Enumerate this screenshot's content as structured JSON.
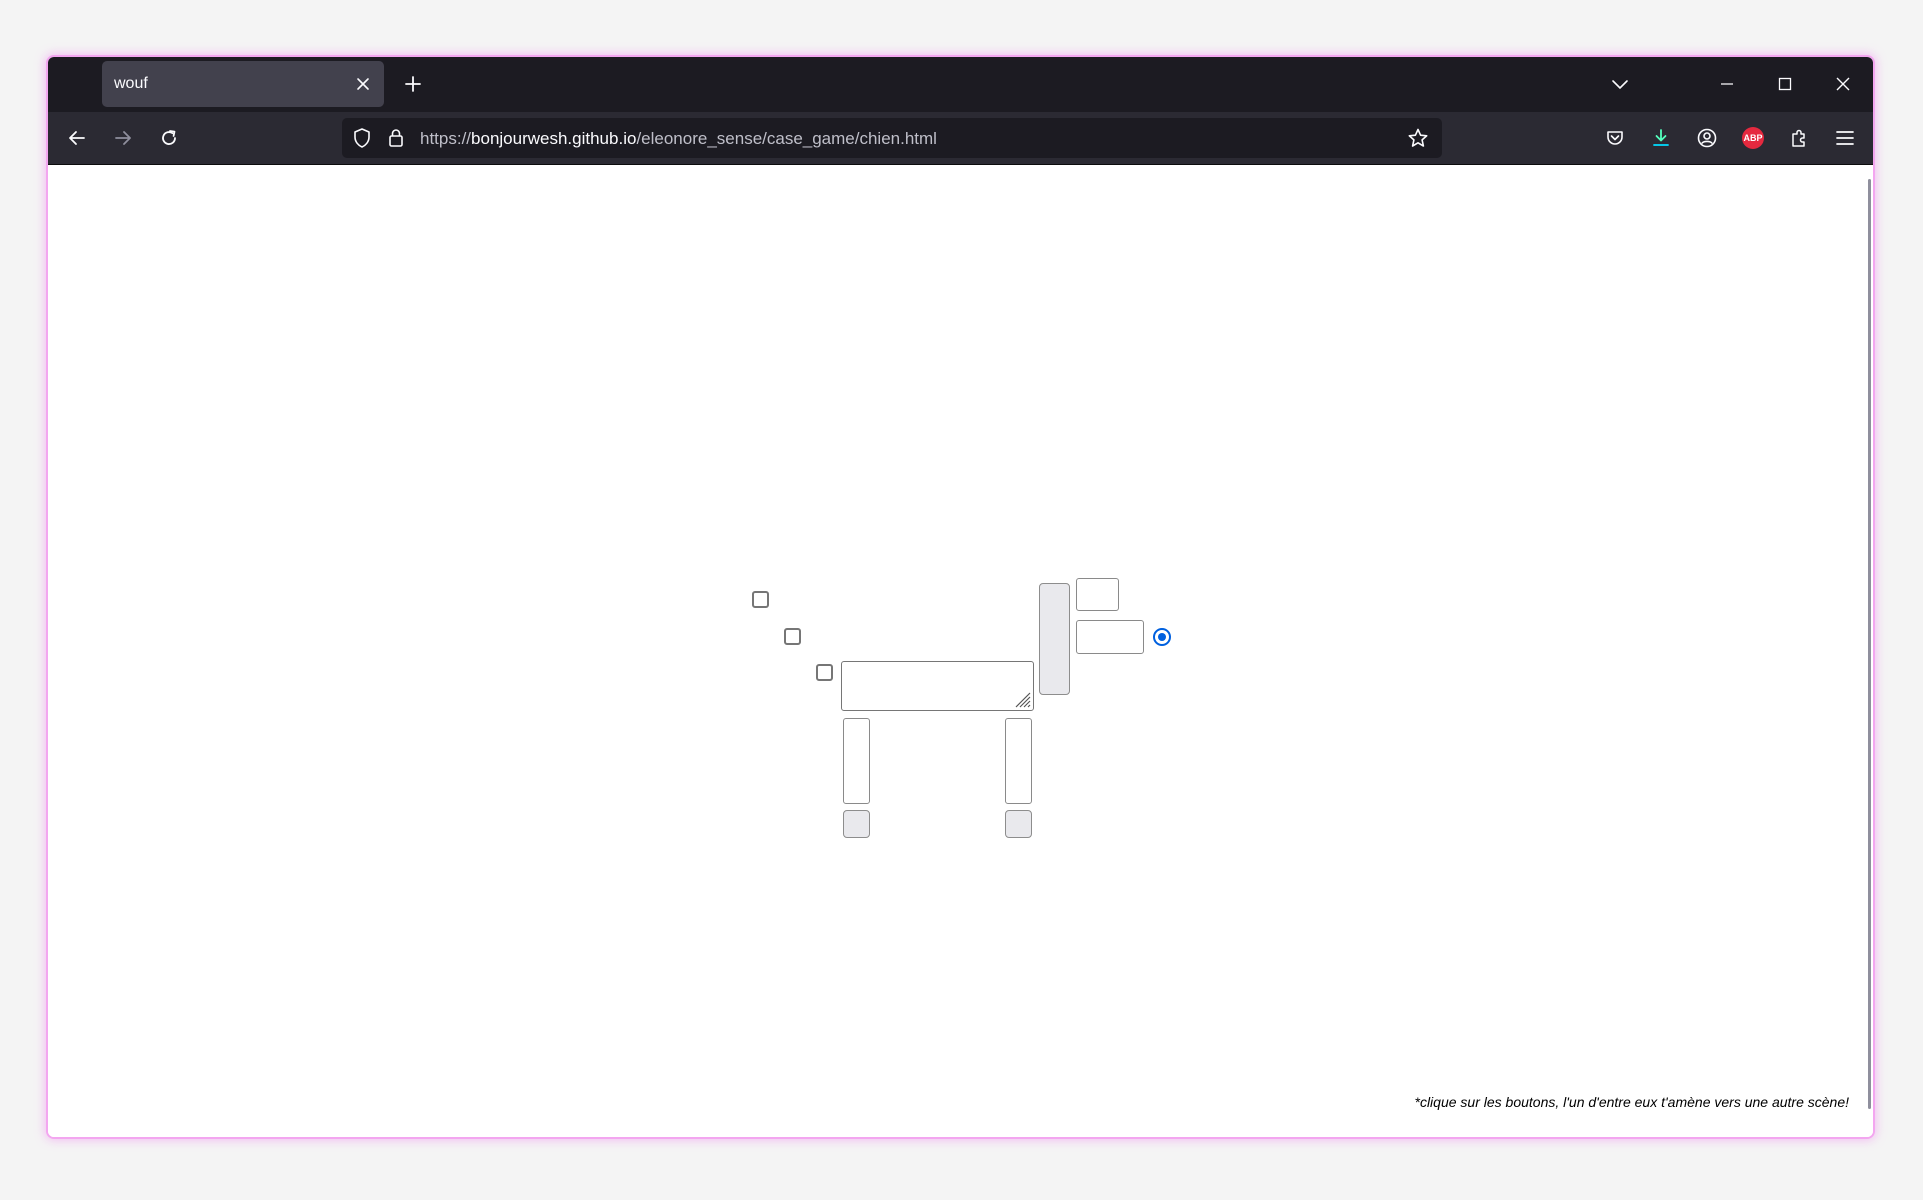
{
  "browser": {
    "tab": {
      "title": "wouf"
    },
    "url": {
      "scheme": "https://",
      "host": "bonjourwesh.github.io",
      "path": "/eleonore_sense/case_game/chien.html"
    },
    "extension_badge": "ABP",
    "accent_color": "#f3a6f0",
    "icons": {
      "tab_close": "close-icon",
      "new_tab": "plus-icon",
      "tab_list": "chevron-down-icon",
      "minimize": "minimize-icon",
      "maximize": "maximize-icon",
      "close_window": "close-icon",
      "back": "back-arrow-icon",
      "forward": "forward-arrow-icon",
      "reload": "reload-icon",
      "tracking_protection": "shield-icon",
      "secure": "lock-icon",
      "bookmark": "star-icon",
      "pocket": "pocket-icon",
      "downloads": "download-icon",
      "account": "account-icon",
      "extensions": "puzzle-icon",
      "menu": "hamburger-menu-icon"
    }
  },
  "page": {
    "footnote": "*clique sur les boutons, l'un d'entre eux t'amène vers une autre scène!",
    "radio_color": "#0060df",
    "tail_checkboxes": [
      {
        "checked": false
      },
      {
        "checked": false
      },
      {
        "checked": false
      }
    ],
    "ear_radio": {
      "checked": true
    }
  }
}
